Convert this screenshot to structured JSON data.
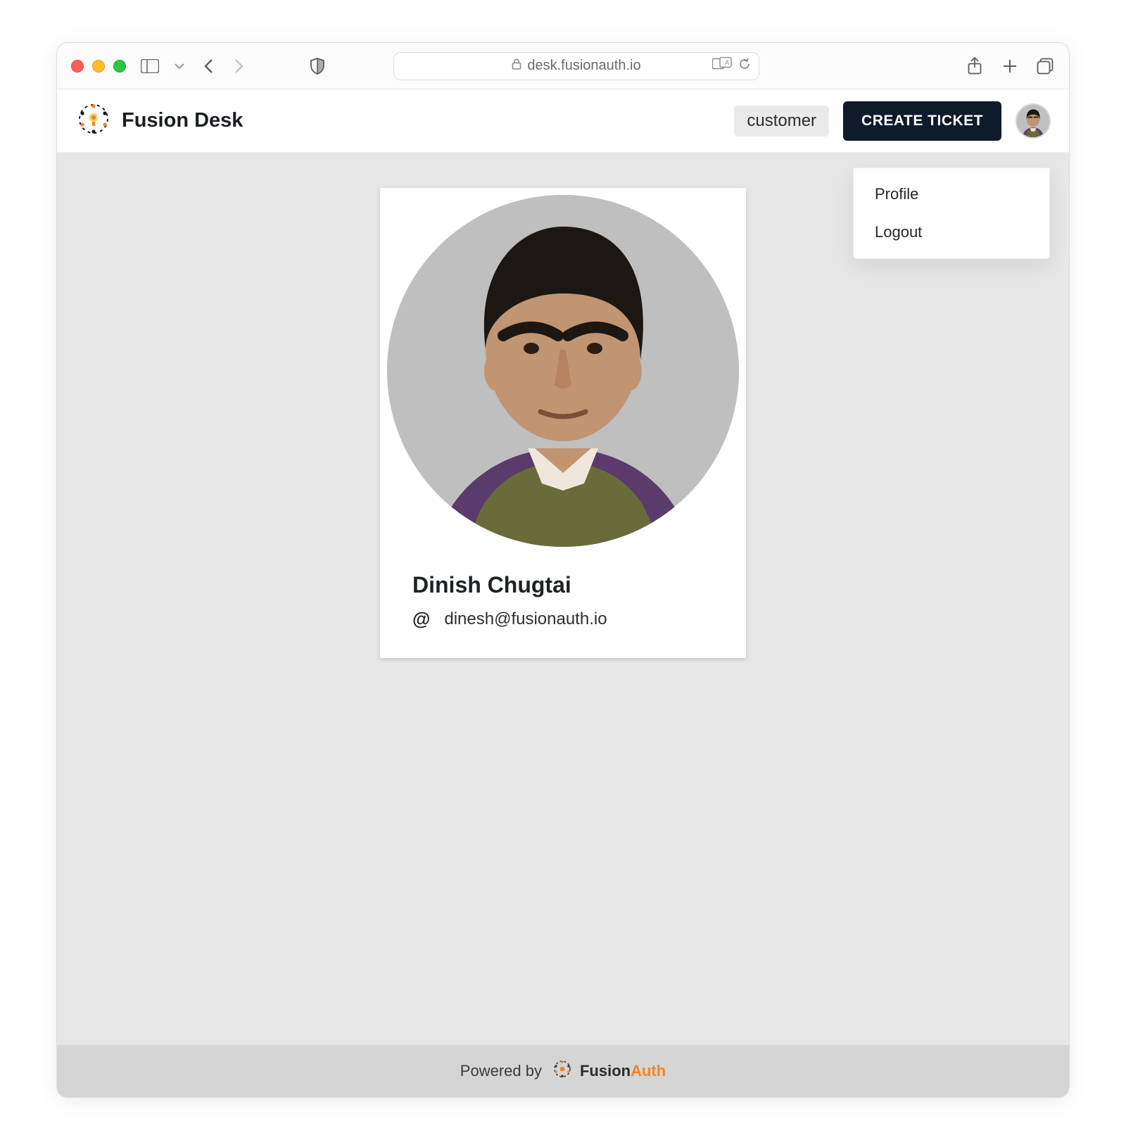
{
  "browser": {
    "url": "desk.fusionauth.io"
  },
  "header": {
    "app_title": "Fusion Desk",
    "role_chip": "customer",
    "create_ticket_label": "CREATE TICKET"
  },
  "user_menu": {
    "items": [
      {
        "label": "Profile"
      },
      {
        "label": "Logout"
      }
    ]
  },
  "profile": {
    "name": "Dinish Chugtai",
    "email": "dinesh@fusionauth.io"
  },
  "footer": {
    "powered_by": "Powered by",
    "brand_first": "Fusion",
    "brand_second": "Auth"
  },
  "colors": {
    "accent_dark": "#0f1a2b",
    "brand_orange": "#f5821f"
  }
}
